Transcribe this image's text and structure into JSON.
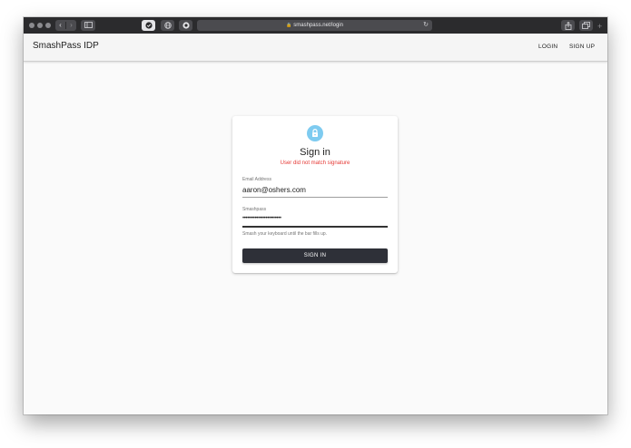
{
  "browser": {
    "url": "smashpass.net/login"
  },
  "app": {
    "brand": "SmashPass IDP",
    "nav": {
      "login": "LOGIN",
      "signup": "SIGN UP"
    }
  },
  "signin": {
    "title": "Sign in",
    "error": "User did not match signature",
    "email_label": "Email Address",
    "email_value": "aaron@oshers.com",
    "smashpass_label": "Smashpass",
    "smashpass_value": "•••••••••••••••••••••••••",
    "helper": "Smash your keyboard until the bar fills up.",
    "button": "SIGN IN"
  },
  "icons": {
    "lock": "lock-icon",
    "back": "chevron-left-icon",
    "forward": "chevron-right-icon",
    "reload": "reload-icon",
    "share": "share-icon",
    "tabs": "tabs-icon"
  },
  "colors": {
    "avatar": "#7ecbf0",
    "error": "#e53935",
    "button": "#2e3038"
  }
}
